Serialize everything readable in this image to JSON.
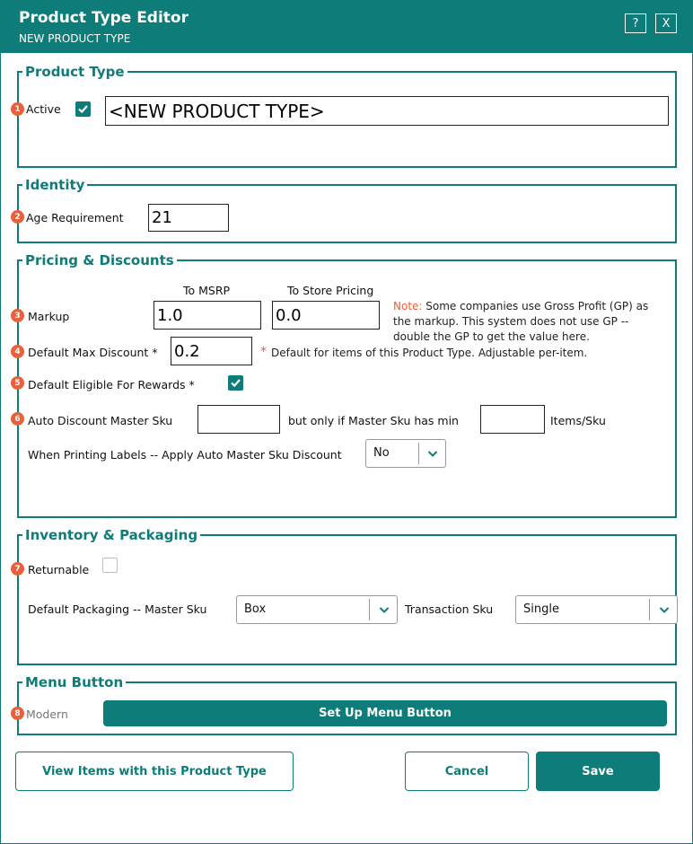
{
  "window": {
    "title": "Product Type Editor",
    "subtitle": "NEW PRODUCT TYPE",
    "help_label": "?",
    "close_label": "X"
  },
  "theme": {
    "accent": "#0e7c79",
    "badge": "#e8603c",
    "note": "#e8603c"
  },
  "product_type": {
    "legend": "Product Type",
    "badge": "1",
    "active_label": "Active",
    "active_checked": true,
    "name_value": "<NEW PRODUCT TYPE>"
  },
  "identity": {
    "legend": "Identity",
    "badge": "2",
    "age_label": "Age Requirement",
    "age_value": "21"
  },
  "pricing": {
    "legend": "Pricing & Discounts",
    "col_msrp": "To MSRP",
    "col_store": "To Store Pricing",
    "markup_badge": "3",
    "markup_label": "Markup",
    "markup_msrp_value": "1.0",
    "markup_store_value": "0.0",
    "note_prefix": "Note:",
    "note_text": "Some companies use Gross Profit (GP) as the markup. This system does not use GP -- double the GP to get the value here.",
    "max_discount_badge": "4",
    "max_discount_label": "Default Max Discount *",
    "max_discount_value": "0.2",
    "asterisk": "*",
    "max_discount_note": "Default for items of this Product Type. Adjustable per-item.",
    "rewards_badge": "5",
    "rewards_label": "Default Eligible For Rewards *",
    "rewards_checked": true,
    "auto_badge": "6",
    "auto_label": "Auto Discount Master Sku",
    "auto_value": "",
    "auto_mid_label": "but only if Master Sku has min",
    "min_value": "",
    "items_label": "Items/Sku",
    "print_label": "When Printing Labels -- Apply Auto Master Sku Discount",
    "print_value": "No"
  },
  "inventory": {
    "legend": "Inventory & Packaging",
    "returnable_badge": "7",
    "returnable_label": "Returnable",
    "returnable_checked": false,
    "packaging_label": "Default Packaging -- Master Sku",
    "packaging_value": "Box",
    "transaction_label": "Transaction Sku",
    "transaction_value": "Single"
  },
  "menu": {
    "legend": "Menu Button",
    "badge": "8",
    "modern_label": "Modern",
    "setup_label": "Set Up Menu Button"
  },
  "footer": {
    "view_items_label": "View Items with this Product Type",
    "cancel_label": "Cancel",
    "save_label": "Save"
  },
  "icons": {
    "check": "check-icon",
    "chevron": "chevron-down-icon"
  }
}
